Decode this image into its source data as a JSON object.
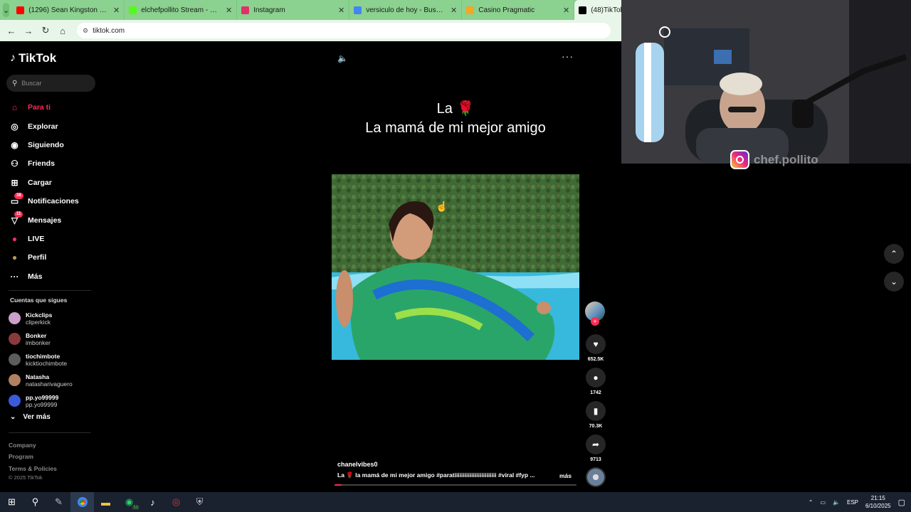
{
  "browser": {
    "tabs": [
      {
        "label": "(1296) Sean Kingston - Beautiful",
        "color": "#ff0000"
      },
      {
        "label": "elchefpollito Stream - Watch Live",
        "color": "#53fc18"
      },
      {
        "label": "Instagram",
        "color": "#e1306c"
      },
      {
        "label": "versiculo de hoy - Buscar con Google",
        "color": "#4285f4"
      },
      {
        "label": "Casino Pragmatic",
        "color": "#f5a623"
      },
      {
        "label": "(48)TikTok",
        "color": "#000000"
      }
    ],
    "url": "tiktok.com"
  },
  "sidebar": {
    "logo": "TikTok",
    "search_placeholder": "Buscar",
    "nav": [
      {
        "label": "Para ti",
        "icon": "home-icon",
        "glyph": "⌂"
      },
      {
        "label": "Explorar",
        "icon": "compass-icon",
        "glyph": "◎"
      },
      {
        "label": "Siguiendo",
        "icon": "following-icon",
        "glyph": "◉"
      },
      {
        "label": "Friends",
        "icon": "friends-icon",
        "glyph": "⚇"
      },
      {
        "label": "Cargar",
        "icon": "upload-icon",
        "glyph": "⊞"
      },
      {
        "label": "Notificaciones",
        "icon": "inbox-icon",
        "glyph": "▭",
        "badge": "38"
      },
      {
        "label": "Mensajes",
        "icon": "send-icon",
        "glyph": "▽",
        "badge": "11"
      },
      {
        "label": "LIVE",
        "icon": "live-icon",
        "glyph": "●"
      },
      {
        "label": "Perfil",
        "icon": "profile-icon",
        "glyph": "●"
      },
      {
        "label": "Más",
        "icon": "more-icon",
        "glyph": "···"
      }
    ],
    "following_title": "Cuentas que sigues",
    "following": [
      {
        "name": "Kickclips",
        "handle": "cliperkick",
        "color": "#c9a0c9"
      },
      {
        "name": "Bonker",
        "handle": "imbonker",
        "color": "#8a3a3a"
      },
      {
        "name": "tiochimbote",
        "handle": "kicktiochimbote",
        "color": "#5c5c5c"
      },
      {
        "name": "Natasha",
        "handle": "natasharivaguero",
        "color": "#b08060"
      },
      {
        "name": "pp.yo99999",
        "handle": "pp.yo99999",
        "color": "#3b5bdb"
      }
    ],
    "ver_mas": "Ver más",
    "footer_links": [
      "Company",
      "Program",
      "Terms & Policies"
    ],
    "copyright": "© 2025 TikTok"
  },
  "video": {
    "title_line1": "La 🌹",
    "title_line2": "La mamá de mi mejor amigo",
    "author": "chanelvibes0",
    "description": "La 🌹 la mamá de mi mejor amigo #paratiiiiiiiiiiiiiiiiiiiiiiiii #viral #fyp ...",
    "more_label": "más",
    "progress": 0.03,
    "likes": "652.5K",
    "comments": "1742",
    "saves": "70.3K",
    "shares": "9713"
  },
  "overlay": {
    "instagram_handle": "chef.pollito"
  },
  "taskbar": {
    "whatsapp_badge": "53",
    "language": "ESP",
    "time": "21:15",
    "date": "6/10/2025"
  },
  "colors": {
    "accent": "#fe2c55",
    "tab_bg": "#8bd18f"
  }
}
